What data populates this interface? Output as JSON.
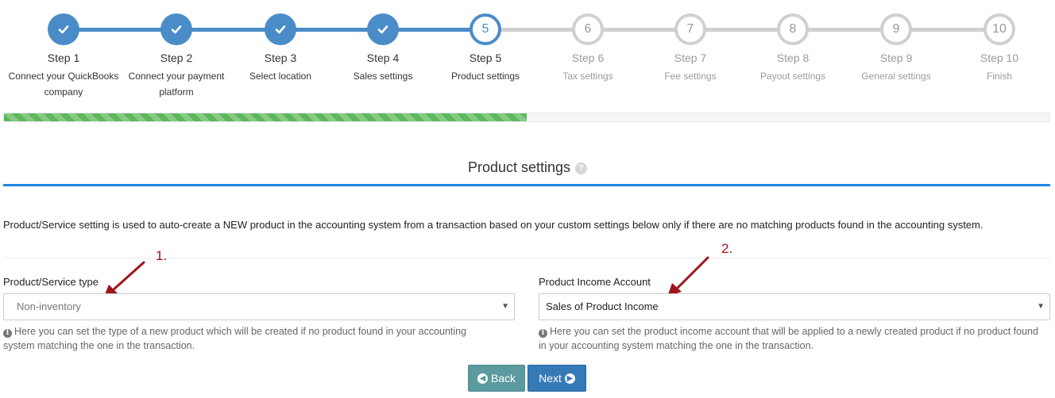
{
  "stepper": {
    "steps": [
      {
        "icon": "check-icon",
        "title": "Step 1",
        "sub": "Connect your QuickBooks company",
        "state": "done"
      },
      {
        "icon": "check-icon",
        "title": "Step 2",
        "sub": "Connect your payment platform",
        "state": "done"
      },
      {
        "icon": "check-icon",
        "title": "Step 3",
        "sub": "Select location",
        "state": "done"
      },
      {
        "icon": "check-icon",
        "title": "Step 4",
        "sub": "Sales settings",
        "state": "done"
      },
      {
        "number": "5",
        "title": "Step 5",
        "sub": "Product settings",
        "state": "current"
      },
      {
        "number": "6",
        "title": "Step 6",
        "sub": "Tax settings",
        "state": "todo"
      },
      {
        "number": "7",
        "title": "Step 7",
        "sub": "Fee settings",
        "state": "todo"
      },
      {
        "number": "8",
        "title": "Step 8",
        "sub": "Payout settings",
        "state": "todo"
      },
      {
        "number": "9",
        "title": "Step 9",
        "sub": "General settings",
        "state": "todo"
      },
      {
        "number": "10",
        "title": "Step 10",
        "sub": "Finish",
        "state": "todo"
      }
    ]
  },
  "progress": {
    "percent": 50,
    "color": "#5cb85c"
  },
  "section": {
    "title": "Product settings",
    "help_icon": "question-circle-icon",
    "description": "Product/Service setting is used to auto-create a NEW product in the accounting system from a transaction based on your custom settings below only if there are no matching products found in the accounting system."
  },
  "annotations": {
    "one": "1.",
    "two": "2.",
    "color": "#a0141e"
  },
  "fields": {
    "product_type": {
      "label": "Product/Service type",
      "value": "Non-inventory",
      "hint": "Here you can set the type of a new product which will be created if no product found in your accounting system matching the one in the transaction."
    },
    "income_account": {
      "label": "Product Income Account",
      "value": "Sales of Product Income",
      "hint": "Here you can set the product income account that will be applied to a newly created product if no product found in your accounting system matching the one in the transaction."
    }
  },
  "buttons": {
    "back": "Back",
    "next": "Next"
  },
  "colors": {
    "accent": "#4a8cc7",
    "rule": "#1e88e5",
    "next": "#337ab7",
    "back": "#5b9a9e"
  }
}
